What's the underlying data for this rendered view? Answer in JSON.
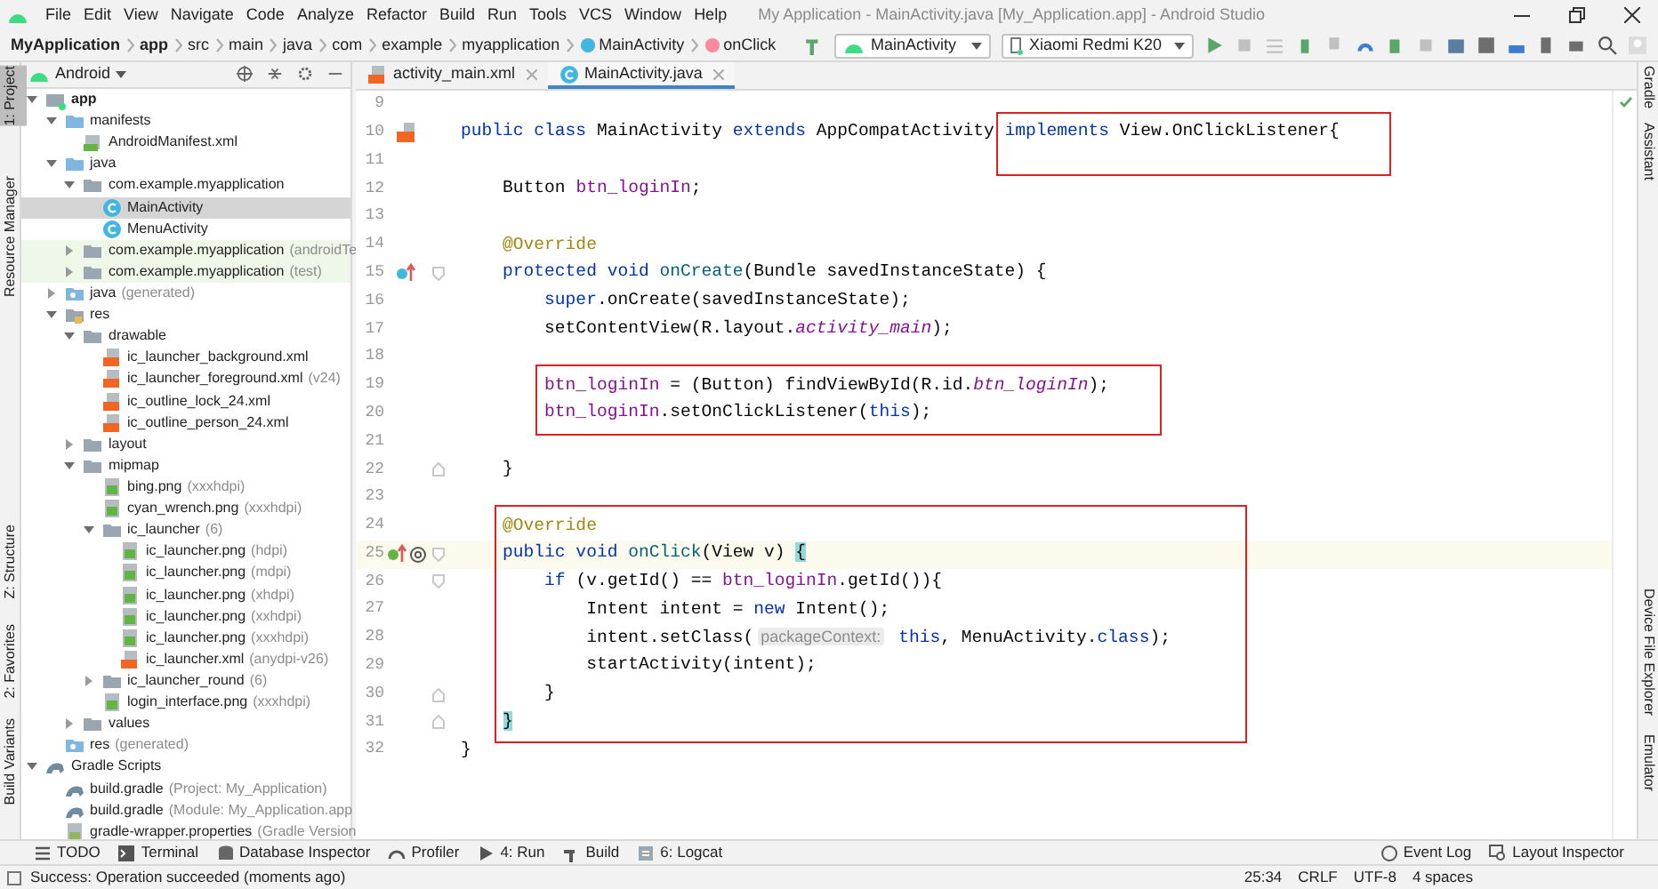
{
  "menu": [
    "File",
    "Edit",
    "View",
    "Navigate",
    "Code",
    "Analyze",
    "Refactor",
    "Build",
    "Run",
    "Tools",
    "VCS",
    "Window",
    "Help"
  ],
  "window": {
    "title": "My Application - MainActivity.java [My_Application.app] - Android Studio"
  },
  "breadcrumb": [
    {
      "text": "MyApplication",
      "kind": "bold"
    },
    {
      "text": "app",
      "kind": "bold"
    },
    {
      "text": "src",
      "kind": "plain"
    },
    {
      "text": "main",
      "kind": "plain"
    },
    {
      "text": "java",
      "kind": "plain"
    },
    {
      "text": "com",
      "kind": "plain"
    },
    {
      "text": "example",
      "kind": "plain"
    },
    {
      "text": "myapplication",
      "kind": "plain"
    },
    {
      "text": "MainActivity",
      "kind": "class"
    },
    {
      "text": "onClick",
      "kind": "method"
    }
  ],
  "toolbar": {
    "run_config": "MainActivity",
    "device": "Xiaomi Redmi K20"
  },
  "left_strip": [
    {
      "label": "1: Project",
      "selected": true
    },
    {
      "label": "Resource Manager",
      "selected": false
    },
    {
      "label": "Z: Structure",
      "selected": false
    },
    {
      "label": "2: Favorites",
      "selected": false
    },
    {
      "label": "Build Variants",
      "selected": false
    }
  ],
  "right_strip": [
    "Gradle",
    "Assistant",
    "Device File Explorer",
    "Emulator"
  ],
  "project": {
    "view": "Android",
    "tree": [
      {
        "name": "app",
        "kind": "module",
        "bold": true,
        "expanded": true,
        "selected": false,
        "children": [
          {
            "name": "manifests",
            "kind": "folder",
            "expanded": true,
            "selected": false,
            "children": [
              {
                "name": "AndroidManifest.xml",
                "kind": "manifest",
                "selected": false
              }
            ]
          },
          {
            "name": "java",
            "kind": "folder",
            "expanded": true,
            "selected": false,
            "children": [
              {
                "name": "com.example.myapplication",
                "kind": "package",
                "expanded": true,
                "selected": false,
                "children": [
                  {
                    "name": "MainActivity",
                    "kind": "class",
                    "selected": true
                  },
                  {
                    "name": "MenuActivity",
                    "kind": "class",
                    "selected": false
                  }
                ]
              },
              {
                "name": "com.example.myapplication",
                "detail": "(androidTe",
                "kind": "package",
                "expanded": false,
                "test_scope": true,
                "selected": false
              },
              {
                "name": "com.example.myapplication",
                "detail": "(test)",
                "kind": "package",
                "expanded": false,
                "test_scope": true,
                "selected": false
              }
            ]
          },
          {
            "name": "java",
            "detail": "(generated)",
            "kind": "generated",
            "expanded": false,
            "selected": false
          },
          {
            "name": "res",
            "kind": "res",
            "expanded": true,
            "selected": false,
            "children": [
              {
                "name": "drawable",
                "kind": "package",
                "expanded": true,
                "selected": false,
                "children": [
                  {
                    "name": "ic_launcher_background.xml",
                    "kind": "xml",
                    "selected": false
                  },
                  {
                    "name": "ic_launcher_foreground.xml",
                    "detail": "(v24)",
                    "kind": "xml",
                    "selected": false
                  },
                  {
                    "name": "ic_outline_lock_24.xml",
                    "kind": "xml",
                    "selected": false
                  },
                  {
                    "name": "ic_outline_person_24.xml",
                    "kind": "xml",
                    "selected": false
                  }
                ]
              },
              {
                "name": "layout",
                "kind": "package",
                "expanded": false,
                "selected": false
              },
              {
                "name": "mipmap",
                "kind": "package",
                "expanded": true,
                "selected": false,
                "children": [
                  {
                    "name": "bing.png",
                    "detail": "(xxxhdpi)",
                    "kind": "image",
                    "selected": false
                  },
                  {
                    "name": "cyan_wrench.png",
                    "detail": "(xxxhdpi)",
                    "kind": "image",
                    "selected": false
                  },
                  {
                    "name": "ic_launcher",
                    "detail": "(6)",
                    "kind": "package",
                    "expanded": true,
                    "selected": false,
                    "children": [
                      {
                        "name": "ic_launcher.png",
                        "detail": "(hdpi)",
                        "kind": "image",
                        "selected": false
                      },
                      {
                        "name": "ic_launcher.png",
                        "detail": "(mdpi)",
                        "kind": "image",
                        "selected": false
                      },
                      {
                        "name": "ic_launcher.png",
                        "detail": "(xhdpi)",
                        "kind": "image",
                        "selected": false
                      },
                      {
                        "name": "ic_launcher.png",
                        "detail": "(xxhdpi)",
                        "kind": "image",
                        "selected": false
                      },
                      {
                        "name": "ic_launcher.png",
                        "detail": "(xxxhdpi)",
                        "kind": "image",
                        "selected": false
                      },
                      {
                        "name": "ic_launcher.xml",
                        "detail": "(anydpi-v26)",
                        "kind": "xml",
                        "selected": false
                      }
                    ]
                  },
                  {
                    "name": "ic_launcher_round",
                    "detail": "(6)",
                    "kind": "package",
                    "expanded": false,
                    "selected": false
                  },
                  {
                    "name": "login_interface.png",
                    "detail": "(xxxhdpi)",
                    "kind": "image",
                    "selected": false
                  }
                ]
              },
              {
                "name": "values",
                "kind": "package",
                "expanded": false,
                "selected": false
              }
            ]
          },
          {
            "name": "res",
            "detail": "(generated)",
            "kind": "generated",
            "selected": false
          }
        ]
      },
      {
        "name": "Gradle Scripts",
        "kind": "gradle",
        "expanded": true,
        "selected": false,
        "children": [
          {
            "name": "build.gradle",
            "detail": "(Project: My_Application)",
            "kind": "gradle",
            "selected": false
          },
          {
            "name": "build.gradle",
            "detail": "(Module: My_Application.app",
            "kind": "gradle",
            "selected": false
          },
          {
            "name": "gradle-wrapper.properties",
            "detail": "(Gradle Version",
            "kind": "properties",
            "selected": false
          }
        ]
      }
    ]
  },
  "editor": {
    "tabs": [
      {
        "label": "activity_main.xml",
        "kind": "xml",
        "selected": false
      },
      {
        "label": "MainActivity.java",
        "kind": "class",
        "selected": true
      }
    ],
    "lines": [
      {
        "number": "9"
      },
      {
        "number": "10",
        "layout_marker": true,
        "tokens": [
          {
            "text": "public class ",
            "kind": "keyword"
          },
          {
            "text": "MainActivity ",
            "kind": "plain"
          },
          {
            "text": "extends ",
            "kind": "keyword"
          },
          {
            "text": "AppCompatActivity ",
            "kind": "plain"
          },
          {
            "text": "implements ",
            "kind": "keyword",
            "boxed": true
          },
          {
            "text": "View.OnClickListener{",
            "kind": "plain",
            "boxed": true
          }
        ]
      },
      {
        "number": "11"
      },
      {
        "number": "12",
        "tokens": [
          {
            "text": "    Button ",
            "kind": "plain"
          },
          {
            "text": "btn_loginIn",
            "kind": "field"
          },
          {
            "text": ";",
            "kind": "plain"
          }
        ]
      },
      {
        "number": "13"
      },
      {
        "number": "14",
        "tokens": [
          {
            "text": "    @Override",
            "kind": "annotation"
          }
        ]
      },
      {
        "number": "15",
        "override_marker": true,
        "fold_start": true,
        "tokens": [
          {
            "text": "    protected void ",
            "kind": "keyword"
          },
          {
            "text": "onCreate",
            "kind": "declaration"
          },
          {
            "text": "(Bundle savedInstanceState) {",
            "kind": "plain"
          }
        ]
      },
      {
        "number": "16",
        "tokens": [
          {
            "text": "        super",
            "kind": "keyword"
          },
          {
            "text": ".onCreate(savedInstanceState);",
            "kind": "plain"
          }
        ]
      },
      {
        "number": "17",
        "tokens": [
          {
            "text": "        setContentView(R.layout.",
            "kind": "plain"
          },
          {
            "text": "activity_main",
            "kind": "static"
          },
          {
            "text": ");",
            "kind": "plain"
          }
        ]
      },
      {
        "number": "18"
      },
      {
        "number": "19",
        "tokens": [
          {
            "text": "        btn_loginIn",
            "kind": "field",
            "boxed": true
          },
          {
            "text": " = (Button) findViewById(R.id.",
            "kind": "plain",
            "boxed": true
          },
          {
            "text": "btn_loginIn",
            "kind": "static",
            "boxed": true
          },
          {
            "text": ");",
            "kind": "plain",
            "boxed": true
          }
        ]
      },
      {
        "number": "20",
        "tokens": [
          {
            "text": "        btn_loginIn",
            "kind": "field",
            "boxed": true
          },
          {
            "text": ".setOnClickListener(",
            "kind": "plain",
            "boxed": true
          },
          {
            "text": "this",
            "kind": "keyword",
            "boxed": true
          },
          {
            "text": ");",
            "kind": "plain",
            "boxed": true
          }
        ]
      },
      {
        "number": "21"
      },
      {
        "number": "22",
        "fold_end": true,
        "tokens": [
          {
            "text": "    }",
            "kind": "plain"
          }
        ]
      },
      {
        "number": "23"
      },
      {
        "number": "24",
        "tokens": [
          {
            "text": "    @Override",
            "kind": "annotation",
            "boxed": true
          }
        ]
      },
      {
        "number": "25",
        "implements_marker": true,
        "fold_start": true,
        "current": true,
        "tokens": [
          {
            "text": "    public void ",
            "kind": "keyword",
            "boxed": true
          },
          {
            "text": "onClick",
            "kind": "declaration",
            "boxed": true
          },
          {
            "text": "(View v) ",
            "kind": "plain",
            "boxed": true
          },
          {
            "text": "{",
            "kind": "brace",
            "boxed": true
          }
        ]
      },
      {
        "number": "26",
        "fold_start": true,
        "tokens": [
          {
            "text": "        if ",
            "kind": "keyword",
            "boxed": true
          },
          {
            "text": "(v.getId() == ",
            "kind": "plain",
            "boxed": true
          },
          {
            "text": "btn_loginIn",
            "kind": "field",
            "boxed": true
          },
          {
            "text": ".getId()){",
            "kind": "plain",
            "boxed": true
          }
        ]
      },
      {
        "number": "27",
        "tokens": [
          {
            "text": "            Intent intent = ",
            "kind": "plain",
            "boxed": true
          },
          {
            "text": "new ",
            "kind": "keyword",
            "boxed": true
          },
          {
            "text": "Intent();",
            "kind": "plain",
            "boxed": true
          }
        ]
      },
      {
        "number": "28",
        "tokens": [
          {
            "text": "            intent.setClass(",
            "kind": "plain",
            "boxed": true
          },
          {
            "text": "packageContext:",
            "kind": "hint",
            "boxed": true
          },
          {
            "text": " this",
            "kind": "keyword",
            "boxed": true
          },
          {
            "text": ", MenuActivity.",
            "kind": "plain",
            "boxed": true
          },
          {
            "text": "class",
            "kind": "keyword",
            "boxed": true
          },
          {
            "text": ");",
            "kind": "plain",
            "boxed": true
          }
        ]
      },
      {
        "number": "29",
        "tokens": [
          {
            "text": "            startActivity(intent);",
            "kind": "plain",
            "boxed": true
          }
        ]
      },
      {
        "number": "30",
        "fold_end": true,
        "tokens": [
          {
            "text": "        }",
            "kind": "plain",
            "boxed": true
          }
        ]
      },
      {
        "number": "31",
        "fold_end": true,
        "tokens": [
          {
            "text": "    }",
            "kind": "brace",
            "boxed": true
          }
        ]
      },
      {
        "number": "32",
        "tokens": [
          {
            "text": "}",
            "kind": "plain"
          }
        ]
      }
    ]
  },
  "bottom_tools": {
    "left": [
      {
        "label": "TODO",
        "kind": "list"
      },
      {
        "label": "Terminal",
        "kind": "terminal"
      },
      {
        "label": "Database Inspector",
        "kind": "database"
      },
      {
        "label": "Profiler",
        "kind": "gauge"
      },
      {
        "label": "4: Run",
        "kind": "run"
      },
      {
        "label": "Build",
        "kind": "hammer"
      },
      {
        "label": "6: Logcat",
        "kind": "logcat"
      }
    ],
    "right": [
      {
        "label": "Event Log",
        "kind": "bubble"
      },
      {
        "label": "Layout Inspector",
        "kind": "inspect"
      }
    ]
  },
  "status_bar": {
    "message": "Success: Operation succeeded (moments ago)",
    "items": [
      "25:34",
      "CRLF",
      "UTF-8",
      "4 spaces"
    ]
  }
}
